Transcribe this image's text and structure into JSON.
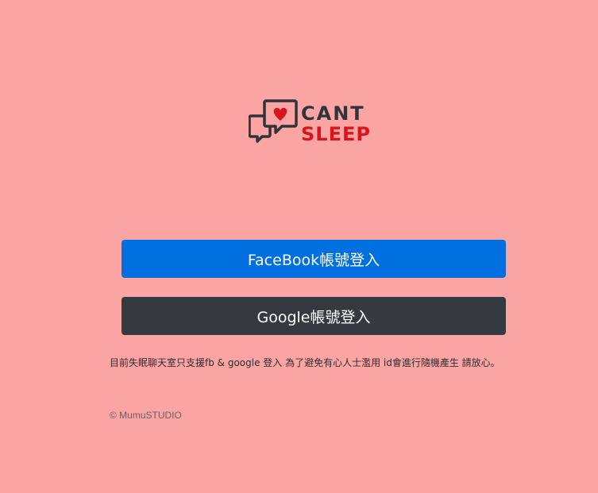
{
  "logo": {
    "line1": "CANT",
    "line2": "SLEEP",
    "colors": {
      "dark": "#2e3438",
      "red": "#d9141c"
    }
  },
  "buttons": {
    "facebook_label": "FaceBook帳號登入",
    "google_label": "Google帳號登入"
  },
  "notice": "目前失眠聊天室只支援fb & google 登入 為了避免有心人士濫用 id會進行隨機產生 請放心。",
  "footer": "© MumuSTUDIO",
  "colors": {
    "background": "#fba4a4",
    "facebook": "#006fe0",
    "google": "#343a40"
  }
}
